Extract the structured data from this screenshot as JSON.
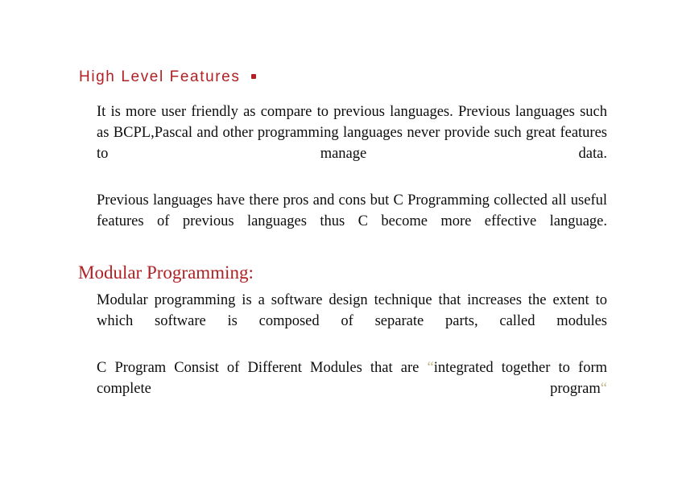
{
  "slide": {
    "background_color": "#ffffff",
    "heading_color": "#B02024",
    "body_color": "#0d0d0d",
    "quote_color": "#C6B68A"
  },
  "sections": [
    {
      "heading": "High Level Features",
      "heading_bullet_icon": "square-bullet-icon",
      "paragraphs": [
        {
          "lines": [
            "It is more user friendly as compare to previous",
            "languages. Previous languages such as BCPL,Pascal and",
            "other programming languages never provide such great",
            "features to manage data."
          ],
          "text": "It is more user friendly as compare to previous languages. Previous languages such as BCPL,Pascal and other programming languages never provide such great features to manage data."
        },
        {
          "lines": [
            "Previous languages have there pros and cons but C",
            "Programming collected all useful features of previous",
            "languages thus C become more effective language."
          ],
          "text": "Previous languages have there pros and cons but C Programming collected all useful features of previous languages thus C become more effective language."
        }
      ]
    },
    {
      "heading": "Modular Programming:",
      "paragraphs": [
        {
          "lines": [
            "Modular programming is a software design technique",
            "that increases the extent to which software is composed",
            "of separate parts, called modules"
          ],
          "text": "Modular programming is a software design technique that increases the extent to which software is composed of separate parts, called modules"
        },
        {
          "segments": {
            "before_quote": "C Program  Consist of Different  Modules that are ",
            "open_quote": "“",
            "quoted_text": "integrated together to form complete  program",
            "close_quote": "“"
          },
          "text": "C Program Consist of Different Modules that are “integrated together to form complete program“"
        }
      ]
    }
  ]
}
